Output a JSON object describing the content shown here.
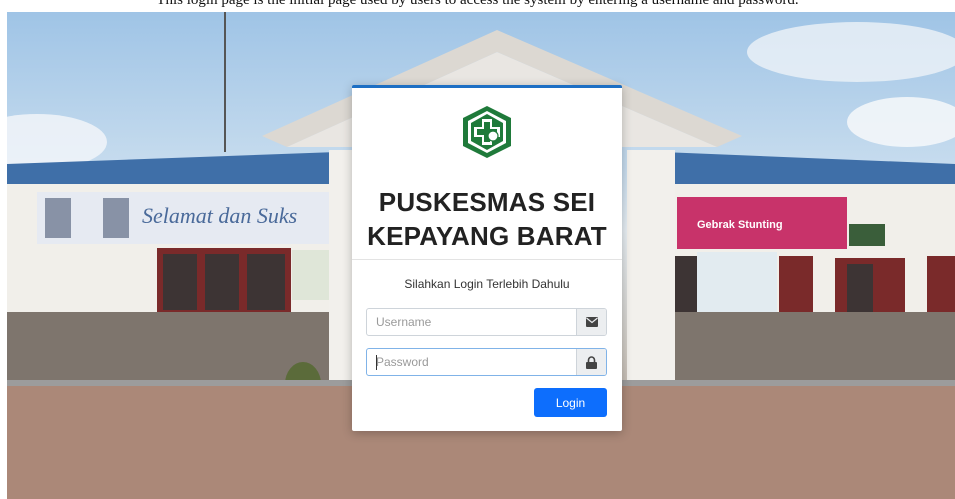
{
  "page_caption": "This login page is the initial page used by users to access the system by entering a username and password.",
  "background": {
    "banner_left_text": "Selamat dan Suks",
    "banner_right_text": "Gebrak Stunting"
  },
  "login": {
    "title_line1": "PUSKESMAS SEI",
    "title_line2": "KEPAYANG BARAT",
    "subtitle": "Silahkan Login Terlebih Dahulu",
    "username_placeholder": "Username",
    "username_value": "",
    "password_placeholder": "Password",
    "password_value": "",
    "username_icon": "envelope-icon",
    "password_icon": "lock-icon",
    "button_label": "Login"
  },
  "colors": {
    "accent": "#0d6efd",
    "card_top_border": "#1d6fc4",
    "logo_green": "#1f7a3a",
    "title_text": "#222222"
  }
}
